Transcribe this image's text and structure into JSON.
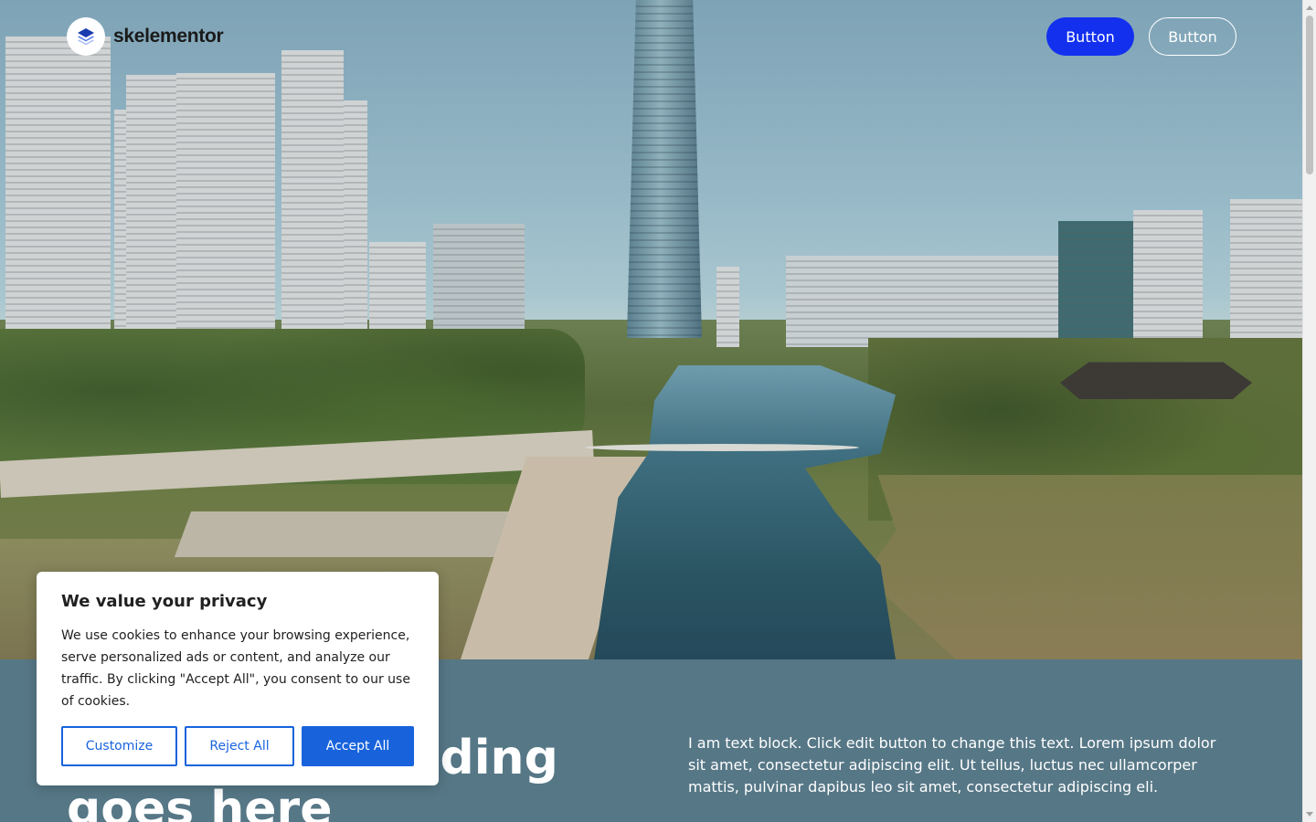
{
  "header": {
    "logo_text": "skelementor",
    "logo_icon": "stacked-layers-icon",
    "primary_button": "Button",
    "secondary_button": "Button"
  },
  "hero": {
    "heading": "Your hero heading goes here",
    "text_block": "I am text block. Click edit button to change this text. Lorem ipsum dolor sit amet, consectetur adipiscing elit. Ut tellus, luctus nec ullamcorper mattis, pulvinar dapibus leo sit amet, consectetur adipiscing eli."
  },
  "cookie_banner": {
    "title": "We value your privacy",
    "body": "We use cookies to enhance your browsing experience, serve personalized ads or content, and analyze our traffic. By clicking \"Accept All\", you consent to our use of cookies.",
    "customize": "Customize",
    "reject": "Reject All",
    "accept": "Accept All"
  },
  "colors": {
    "primary_button": "#1330ef",
    "band": "#567786",
    "cookie_accent": "#1863dc"
  }
}
